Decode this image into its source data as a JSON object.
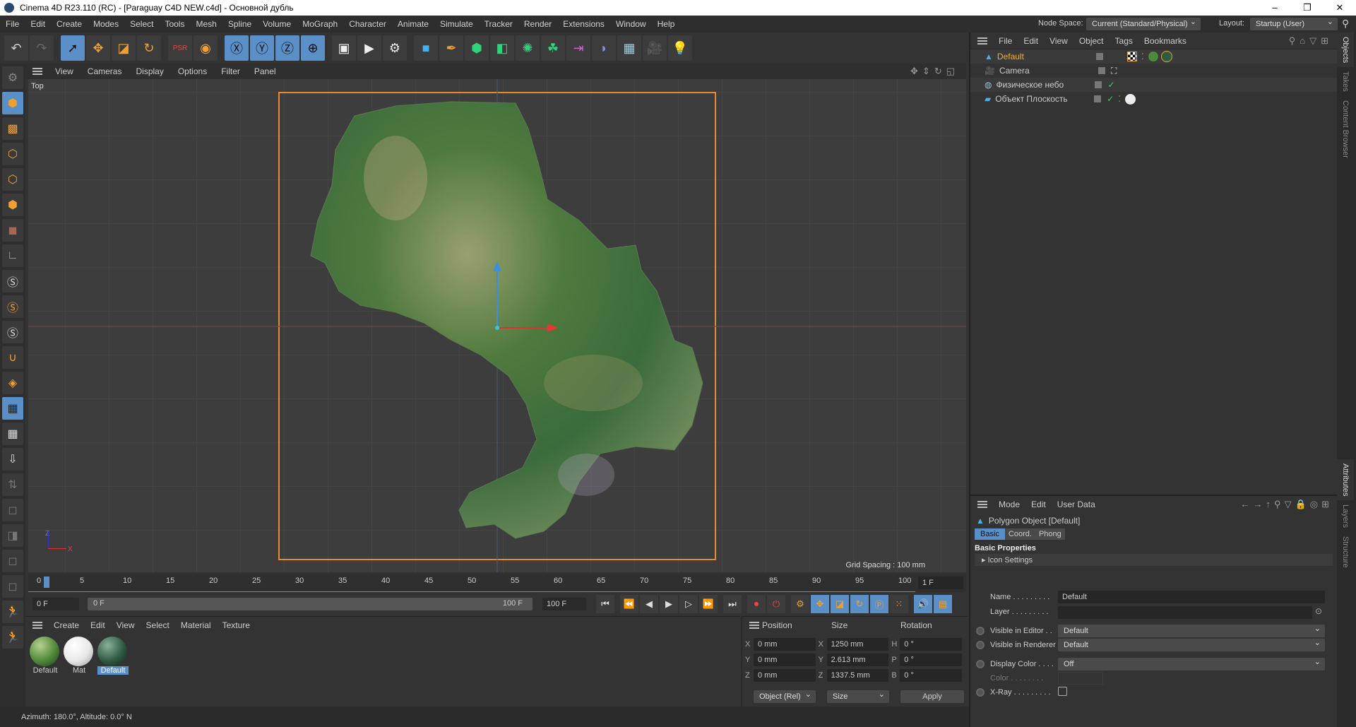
{
  "window": {
    "title": "Cinema 4D R23.110 (RC) - [Paraguay C4D NEW.c4d] - Основной дубль",
    "minimize": "–",
    "maximize": "❐",
    "close": "✕"
  },
  "menu": [
    "File",
    "Edit",
    "Create",
    "Modes",
    "Select",
    "Tools",
    "Mesh",
    "Spline",
    "Volume",
    "MoGraph",
    "Character",
    "Animate",
    "Simulate",
    "Tracker",
    "Render",
    "Extensions",
    "Window",
    "Help"
  ],
  "node_space": {
    "label": "Node Space:",
    "value": "Current (Standard/Physical)"
  },
  "layout": {
    "label": "Layout:",
    "value": "Startup (User)"
  },
  "viewport": {
    "menu": [
      "View",
      "Cameras",
      "Display",
      "Options",
      "Filter",
      "Panel"
    ],
    "view_name": "Top",
    "grid_spacing": "Grid Spacing : 100 mm",
    "axis_x": "X",
    "axis_z": "Z"
  },
  "timeline": {
    "ticks": [
      "0",
      "5",
      "10",
      "15",
      "20",
      "25",
      "30",
      "35",
      "40",
      "45",
      "50",
      "55",
      "60",
      "65",
      "70",
      "75",
      "80",
      "85",
      "90",
      "95",
      "100"
    ],
    "current_frame": "1 F",
    "start": "0 F",
    "range_start": "0 F",
    "range_end": "100 F",
    "end": "100 F"
  },
  "material_manager": {
    "menu": [
      "Create",
      "Edit",
      "View",
      "Select",
      "Material",
      "Texture"
    ],
    "materials": [
      {
        "name": "Default",
        "color": "#4f8a3a"
      },
      {
        "name": "Mat",
        "color": "#e8e8e8"
      },
      {
        "name": "Default",
        "color": "#2f5a42",
        "selected": true
      }
    ]
  },
  "coord_manager": {
    "headers": [
      "Position",
      "Size",
      "Rotation"
    ],
    "rows": [
      {
        "pl": "X",
        "pv": "0 mm",
        "sl": "X",
        "sv": "1250 mm",
        "rl": "H",
        "rv": "0 °"
      },
      {
        "pl": "Y",
        "pv": "0 mm",
        "sl": "Y",
        "sv": "2.613 mm",
        "rl": "P",
        "rv": "0 °"
      },
      {
        "pl": "Z",
        "pv": "0 mm",
        "sl": "Z",
        "sv": "1337.5 mm",
        "rl": "B",
        "rv": "0 °"
      }
    ],
    "mode": "Object (Rel)",
    "size_mode": "Size",
    "apply": "Apply"
  },
  "status": "Azimuth: 180.0°, Altitude: 0.0°  N",
  "object_manager": {
    "menu": [
      "File",
      "Edit",
      "View",
      "Object",
      "Tags",
      "Bookmarks"
    ],
    "objects": [
      {
        "name": "Default",
        "active": true
      },
      {
        "name": "Camera"
      },
      {
        "name": "Физическое небо"
      },
      {
        "name": "Объект Плоскость"
      }
    ]
  },
  "attributes": {
    "menu": [
      "Mode",
      "Edit",
      "User Data"
    ],
    "object_title": "Polygon Object [Default]",
    "tabs": [
      "Basic",
      "Coord.",
      "Phong"
    ],
    "section": "Basic Properties",
    "group": "Icon Settings",
    "name_label": "Name . . . . . . . . .",
    "name_value": "Default",
    "layer_label": "Layer . . . . . . . . .",
    "visible_editor_label": "Visible in Editor . .",
    "visible_editor": "Default",
    "visible_renderer_label": "Visible in Renderer",
    "visible_renderer": "Default",
    "display_color_label": "Display Color . . . .",
    "display_color": "Off",
    "color_label": "Color . . . . . . . .",
    "xray_label": "X-Ray . . . . . . . . ."
  },
  "side_tabs": [
    "Objects",
    "Takes",
    "Content Browser",
    "Attributes",
    "Layers",
    "Structure"
  ]
}
